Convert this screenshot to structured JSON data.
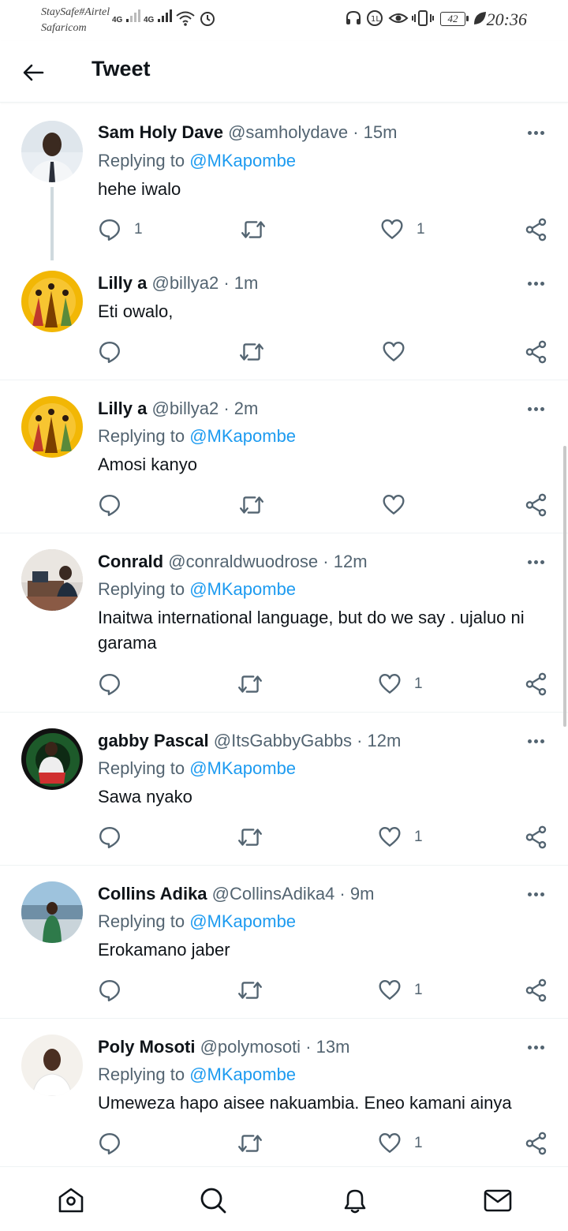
{
  "status_bar": {
    "carrier_line1": "StaySafe#Airtel",
    "carrier_line2": "Safaricom",
    "network1": "4G",
    "network2": "4G",
    "battery": "42",
    "time": "20:36"
  },
  "header": {
    "title": "Tweet"
  },
  "tweets": [
    {
      "name": "Sam Holy Dave",
      "handle": "@samholydave",
      "time": "15m",
      "replying_prefix": "Replying to",
      "replying_to": "@MKapombe",
      "text": "hehe iwalo",
      "replies": "1",
      "retweets": "",
      "likes": "1"
    },
    {
      "name": "Lilly a",
      "handle": "@billya2",
      "time": "1m",
      "text": "Eti owalo,",
      "replies": "",
      "retweets": "",
      "likes": ""
    },
    {
      "name": "Lilly a",
      "handle": "@billya2",
      "time": "2m",
      "replying_prefix": "Replying to",
      "replying_to": "@MKapombe",
      "text": "Amosi kanyo",
      "replies": "",
      "retweets": "",
      "likes": ""
    },
    {
      "name": "Conrald",
      "handle": "@conraldwuodrose",
      "time": "12m",
      "replying_prefix": "Replying to",
      "replying_to": "@MKapombe",
      "text": "Inaitwa international language, but do we say . ujaluo ni garama",
      "replies": "",
      "retweets": "",
      "likes": "1"
    },
    {
      "name": "gabby Pascal",
      "handle": "@ItsGabbyGabbs",
      "time": "12m",
      "replying_prefix": "Replying to",
      "replying_to": "@MKapombe",
      "text": "Sawa nyako",
      "replies": "",
      "retweets": "",
      "likes": "1"
    },
    {
      "name": "Collins Adika",
      "handle": "@CollinsAdika4",
      "time": "9m",
      "replying_prefix": "Replying to",
      "replying_to": "@MKapombe",
      "text": "Erokamano jaber",
      "replies": "",
      "retweets": "",
      "likes": "1"
    },
    {
      "name": "Poly Mosoti",
      "handle": "@polymosoti",
      "time": "13m",
      "replying_prefix": "Replying to",
      "replying_to": "@MKapombe",
      "text": "Umeweza hapo aisee nakuambia. Eneo kamani ainya",
      "replies": "",
      "retweets": "",
      "likes": "1"
    }
  ],
  "meta_separator": "·",
  "icons": {
    "back": "arrow-left-icon",
    "more": "more-horizontal-icon",
    "reply": "reply-icon",
    "retweet": "retweet-icon",
    "like": "heart-icon",
    "share": "share-icon",
    "nav": [
      "home-icon",
      "search-icon",
      "bell-icon",
      "mail-icon"
    ]
  },
  "colors": {
    "accent": "#1d9bf0",
    "text": "#0f1419",
    "secondary": "#536471",
    "divider": "#eff3f4"
  }
}
